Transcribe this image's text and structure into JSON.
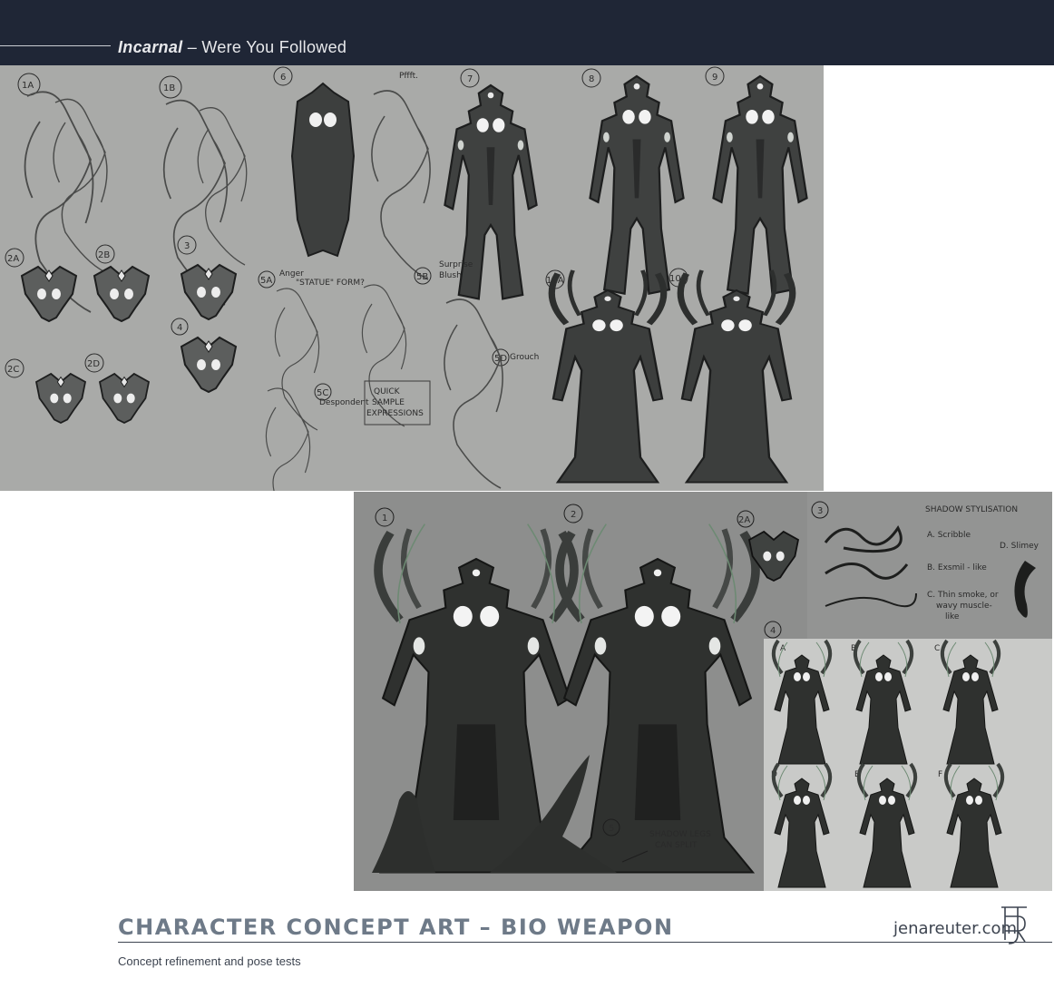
{
  "header": {
    "title_bold": "Incarnal",
    "title_rest": " – Were You Followed"
  },
  "sheet_top": {
    "labels": [
      "1A",
      "1B",
      "6",
      "7",
      "8",
      "9",
      "2A",
      "2B",
      "3",
      "4",
      "2C",
      "2D",
      "5A",
      "5B",
      "5C",
      "5D",
      "10A",
      "10B"
    ],
    "notes": {
      "pffft": "Pffft.",
      "statue": "\"STATUE\" FORM?",
      "anger": "Anger",
      "surprise": "Surprise",
      "blush": "Blush",
      "despondent": "Despondent",
      "grouch": "Grouch",
      "quick1": "QUICK",
      "quick2": "SAMPLE",
      "quick3": "EXPRESSIONS"
    }
  },
  "sheet_bottom": {
    "labels": [
      "1",
      "2",
      "2A",
      "3",
      "4",
      "5"
    ],
    "shadow": {
      "title": "SHADOW STYLISATION",
      "a": "A. Scribble",
      "b": "B. Exsmil - like",
      "c": "C. Thin smoke, or",
      "c2": "wavy muscle-",
      "c3": "like",
      "d": "D. Slimey"
    },
    "panel_letters": [
      "A",
      "B",
      "C",
      "D",
      "E",
      "F"
    ],
    "legs_note1": "SHADOW LEGS",
    "legs_note2": "CAN SPLIT"
  },
  "footer": {
    "title": "CHARACTER CONCEPT ART – BIO WEAPON",
    "url": "jenareuter.com",
    "subtitle": "Concept refinement and pose tests"
  },
  "colors": {
    "topbar": "#1f2636",
    "sheet_top_bg": "#a9aaa8",
    "sheet_bottom_bg": "#8d8e8d",
    "footer_title": "#6e7a88",
    "footer_text": "#3d4450"
  }
}
